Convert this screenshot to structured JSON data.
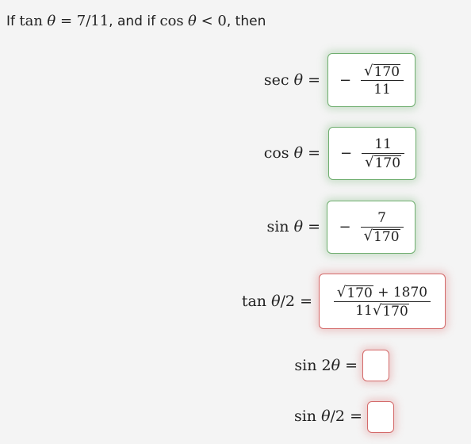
{
  "intro": {
    "prefix": "If ",
    "given_func": "tan",
    "given_var": "θ",
    "given_eq": " = 7/11",
    "mid": ", and if ",
    "cond_func": "cos",
    "cond_var": "θ",
    "cond_rel": " < 0",
    "suffix": ", then"
  },
  "rows": [
    {
      "label_func": "sec ",
      "label_var": "θ",
      "label_tail": "",
      "eq": " =",
      "status": "correct",
      "answer": {
        "sign": "−",
        "num_sqrt": "170",
        "num_plain": "",
        "den_plain": "11",
        "den_sqrt": ""
      }
    },
    {
      "label_func": "cos ",
      "label_var": "θ",
      "label_tail": "",
      "eq": " =",
      "status": "correct",
      "answer": {
        "sign": "−",
        "num_sqrt": "",
        "num_plain": "11",
        "den_plain": "",
        "den_sqrt": "170"
      }
    },
    {
      "label_func": "sin ",
      "label_var": "θ",
      "label_tail": "",
      "eq": " =",
      "status": "correct",
      "answer": {
        "sign": "−",
        "num_sqrt": "",
        "num_plain": "7",
        "den_plain": "",
        "den_sqrt": "170"
      }
    },
    {
      "label_func": "tan ",
      "label_var": "θ",
      "label_tail": "/2",
      "eq": " =",
      "status": "incorrect",
      "answer": {
        "sign": "",
        "num_sqrt": "170",
        "num_plain": " + 1870",
        "den_plain": "11",
        "den_sqrt": "170"
      }
    },
    {
      "label_func": "sin 2",
      "label_var": "θ",
      "label_tail": "",
      "eq": " =",
      "status": "incorrect",
      "answer": null
    },
    {
      "label_func": "sin ",
      "label_var": "θ",
      "label_tail": "/2",
      "eq": " =",
      "status": "incorrect",
      "answer": null
    }
  ],
  "colors": {
    "correct": "#6fae6f",
    "incorrect": "#d46a6a",
    "background": "#f4f4f4"
  },
  "radical_symbol": "√"
}
